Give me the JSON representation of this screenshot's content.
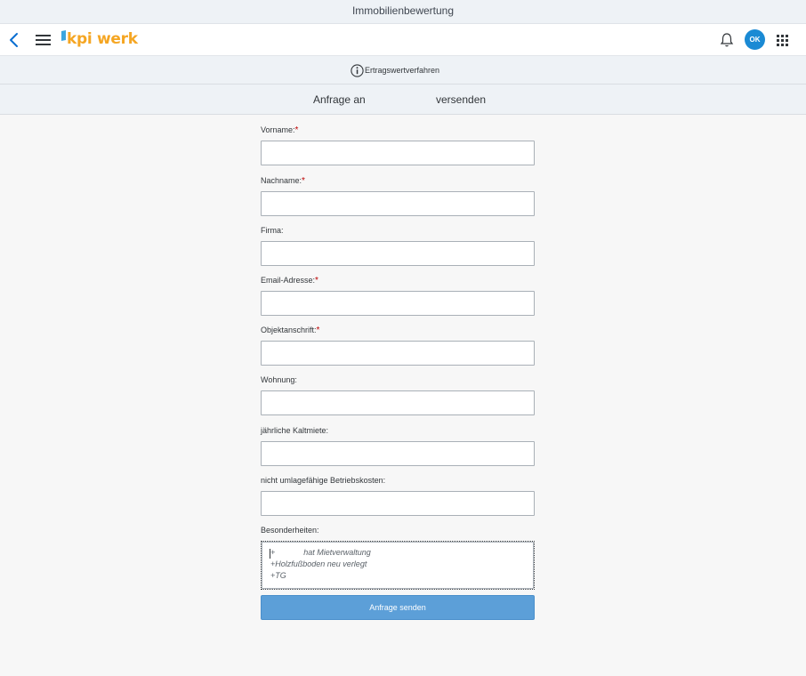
{
  "window": {
    "title": "Immobilienbewertung"
  },
  "shell": {
    "logo_text": "kpi werk",
    "avatar_initials": "OK"
  },
  "subheader": {
    "title": "Ertragswertverfahren"
  },
  "tabs": [
    {
      "label": "Anfrage an"
    },
    {
      "label": "versenden"
    }
  ],
  "form": {
    "fields": [
      {
        "label": "Vorname:",
        "required": "*",
        "value": ""
      },
      {
        "label": "Nachname:",
        "required": "*",
        "value": ""
      },
      {
        "label": "Firma:",
        "required": "",
        "value": ""
      },
      {
        "label": "Email-Adresse:",
        "required": "*",
        "value": ""
      },
      {
        "label": "Objektanschrift:",
        "required": "*",
        "value": ""
      },
      {
        "label": "Wohnung:",
        "required": "",
        "value": ""
      },
      {
        "label": "jährliche Kaltmiete:",
        "required": "",
        "value": ""
      },
      {
        "label": "nicht umlagefähige Betriebskosten:",
        "required": "",
        "value": ""
      }
    ],
    "notes": {
      "label": "Besonderheiten:",
      "line1_prefix": "+",
      "line1_rest": "hat Mietverwaltung",
      "line2": "+Holzfußboden neu verlegt",
      "line3": "+TG"
    },
    "submit_label": "Anfrage senden"
  },
  "colors": {
    "accent": "#5c9fd8",
    "avatar": "#1a8ad4",
    "logo": "#f5a623",
    "required": "#bb0000"
  }
}
